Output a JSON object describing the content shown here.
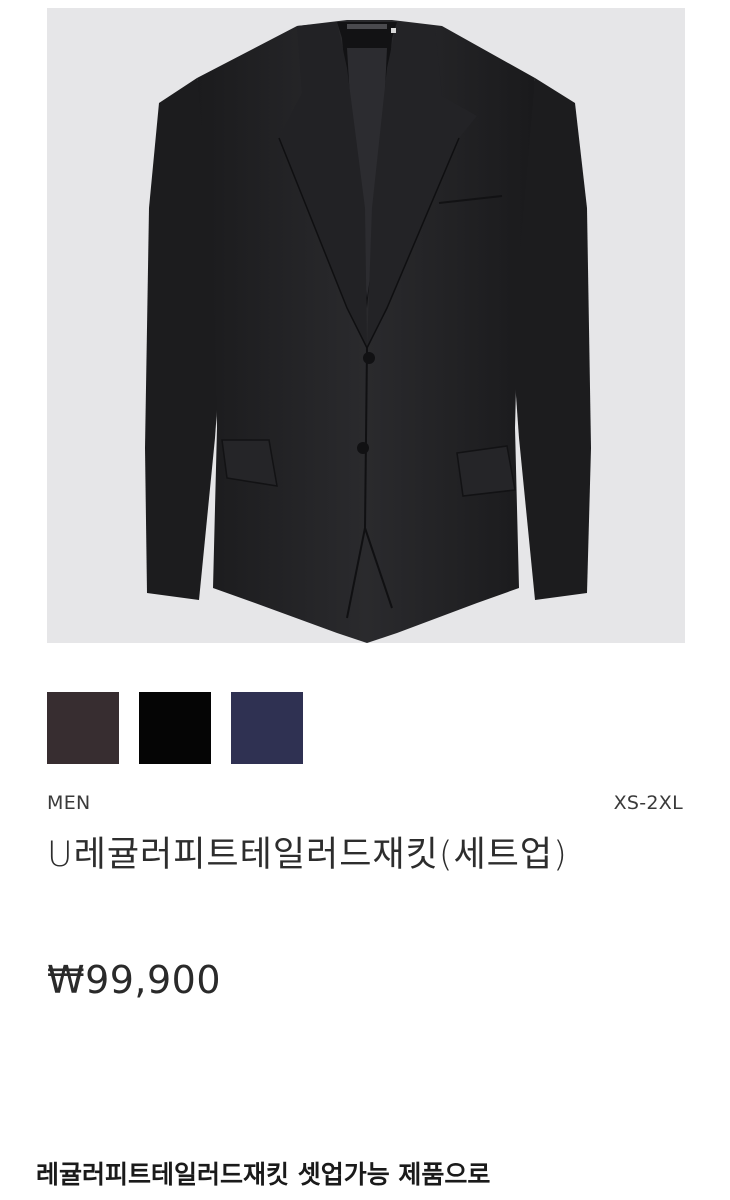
{
  "product": {
    "image_icon": "black-tailored-jacket",
    "swatches": [
      {
        "name": "dark-brown",
        "color": "#372d30"
      },
      {
        "name": "black",
        "color": "#050505"
      },
      {
        "name": "navy",
        "color": "#2f3152"
      }
    ],
    "category": "MEN",
    "size_range": "XS-2XL",
    "name": "U레귤러피트테일러드재킷(세트업)",
    "price": "₩99,900"
  },
  "description": "레귤러피트테일러드재킷 셋업가능 제품으로"
}
